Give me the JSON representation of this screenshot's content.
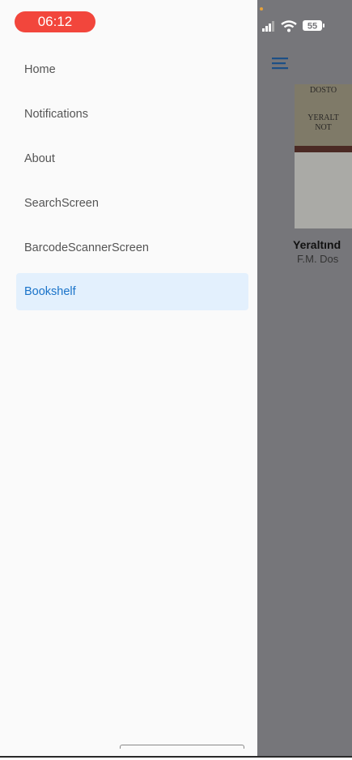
{
  "status_bar": {
    "time": "06:12",
    "battery": "55"
  },
  "drawer": {
    "items": [
      {
        "label": "Home"
      },
      {
        "label": "Notifications"
      },
      {
        "label": "About"
      },
      {
        "label": "SearchScreen"
      },
      {
        "label": "BarcodeScannerScreen"
      },
      {
        "label": "Bookshelf",
        "active": true
      }
    ]
  },
  "background_page": {
    "menu_icon": "hamburger-menu-icon",
    "book": {
      "cover_line1": "DOSTO",
      "cover_line2": "YERALT",
      "cover_line3": "NOT",
      "title": "Yeraltınd",
      "author": "F.M. Dos"
    }
  },
  "colors": {
    "accent": "#1a73c9",
    "active_bg": "#e3f0fd",
    "time_pill": "#f2463c",
    "scrim": "#76767a"
  }
}
